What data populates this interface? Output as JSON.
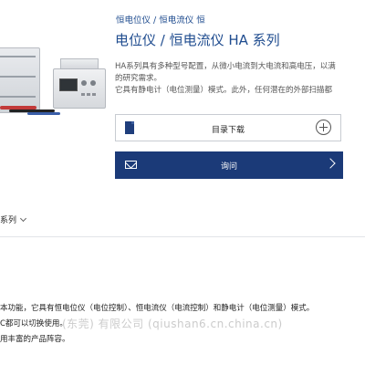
{
  "breadcrumb": "恒电位仪 / 恒电流仪 恒",
  "title": "电位仪 / 恒电流仪 HA 系列",
  "description": {
    "line1": "HA系列具有多种型号配置，从微小电流到大电流和高电压，以满",
    "line2": "的研究需求。",
    "line3": "它具有静电计（电位测量）模式。此外，任何潜在的外部扫描都"
  },
  "catalog_button": {
    "label": "目录下载"
  },
  "inquiry_button": {
    "label": "询问"
  },
  "series_selector": {
    "label": "系列"
  },
  "bottom_text": {
    "line1": "本功能，它具有恒电位仪（电位控制）、恒电流仪（电流控制）和静电计（电位测量）模式。",
    "line2": "C都可以切换使用。",
    "line3": "用丰富的产品阵容。"
  },
  "watermark": "(东莞) 有限公司 (qiushan6.cn.china.cn)",
  "colors": {
    "brand_blue": "#1f4c8f",
    "button_dark": "#1b3a78"
  }
}
